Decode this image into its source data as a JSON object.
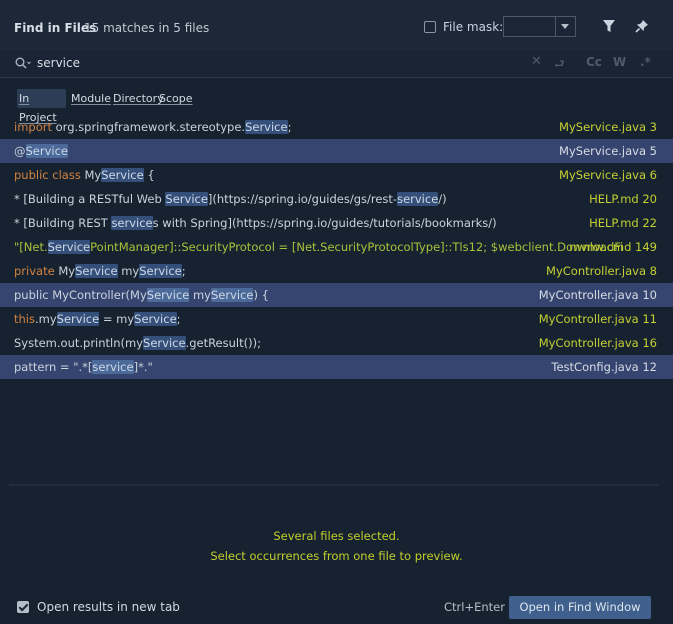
{
  "header": {
    "title": "Find in Files",
    "match_count": "15 matches in 5 files",
    "file_mask_label": "File mask:",
    "file_mask_value": ""
  },
  "search": {
    "query": "service"
  },
  "search_options": {
    "case": "Cc",
    "word": "W",
    "regex": ".*"
  },
  "scopes": [
    "In Project",
    "Module",
    "Directory",
    "Scope"
  ],
  "results": [
    {
      "selected": false,
      "file": "MyService.java 3",
      "parts": [
        [
          "import ",
          "kw"
        ],
        [
          "org.springframework.stereotype.",
          ""
        ],
        [
          "Service",
          "hl"
        ],
        [
          ";",
          ""
        ]
      ]
    },
    {
      "selected": true,
      "file": "MyService.java 5",
      "parts": [
        [
          "@",
          ""
        ],
        [
          "Service",
          "hl"
        ]
      ]
    },
    {
      "selected": false,
      "file": "MyService.java 6",
      "parts": [
        [
          "public class ",
          "kw"
        ],
        [
          "My",
          ""
        ],
        [
          "Service",
          "hl"
        ],
        [
          " {",
          ""
        ]
      ]
    },
    {
      "selected": false,
      "file": "HELP.md 20",
      "parts": [
        [
          "* [Building a RESTful Web ",
          ""
        ],
        [
          "Service",
          "hl"
        ],
        [
          "](https://spring.io/guides/gs/rest-",
          ""
        ],
        [
          "service",
          "hl"
        ],
        [
          "/)",
          ""
        ]
      ]
    },
    {
      "selected": false,
      "file": "HELP.md 22",
      "parts": [
        [
          "* [Building REST ",
          ""
        ],
        [
          "service",
          "hl"
        ],
        [
          "s with Spring](https://spring.io/guides/tutorials/bookmarks/)",
          ""
        ]
      ]
    },
    {
      "selected": false,
      "file": "mvnw.cmd 149",
      "parts": [
        [
          "\"[Net.",
          "str"
        ],
        [
          "Service",
          "hl"
        ],
        [
          "PointManager]::SecurityProtocol = [Net.SecurityProtocolType]::Tls12; $webclient.DownloadFi",
          "str"
        ]
      ]
    },
    {
      "selected": false,
      "file": "MyController.java 8",
      "parts": [
        [
          "private ",
          "kw"
        ],
        [
          "My",
          ""
        ],
        [
          "Service",
          "hl"
        ],
        [
          " my",
          ""
        ],
        [
          "Service",
          "hl"
        ],
        [
          ";",
          ""
        ]
      ]
    },
    {
      "selected": true,
      "file": "MyController.java 10",
      "parts": [
        [
          "public MyController(My",
          ""
        ],
        [
          "Service",
          "hl"
        ],
        [
          " my",
          ""
        ],
        [
          "Service",
          "hl"
        ],
        [
          ") {",
          ""
        ]
      ]
    },
    {
      "selected": false,
      "file": "MyController.java 11",
      "parts": [
        [
          "this",
          "kw"
        ],
        [
          ".my",
          ""
        ],
        [
          "Service",
          "hl"
        ],
        [
          " = my",
          ""
        ],
        [
          "Service",
          "hl"
        ],
        [
          ";",
          ""
        ]
      ]
    },
    {
      "selected": false,
      "file": "MyController.java 16",
      "parts": [
        [
          "System.out.println(my",
          ""
        ],
        [
          "Service",
          "hl"
        ],
        [
          ".getResult());",
          ""
        ]
      ]
    },
    {
      "selected": true,
      "file": "TestConfig.java 12",
      "parts": [
        [
          "pattern = \".*[",
          ""
        ],
        [
          "service",
          "hl"
        ],
        [
          "]*.\"",
          ""
        ]
      ]
    }
  ],
  "preview": {
    "line1": "Several files selected.",
    "line2": "Select occurrences from one file to preview."
  },
  "footer": {
    "open_in_new_tab_label": "Open results in new tab",
    "shortcut": "Ctrl+Enter",
    "open_button_label": "Open in Find Window"
  },
  "colors": {
    "background": "#172230",
    "selected_row": "#36456f",
    "filename": "#c5d032",
    "keyword": "#d2833f",
    "highlight": "#34507a",
    "button": "#3f5f8d"
  }
}
